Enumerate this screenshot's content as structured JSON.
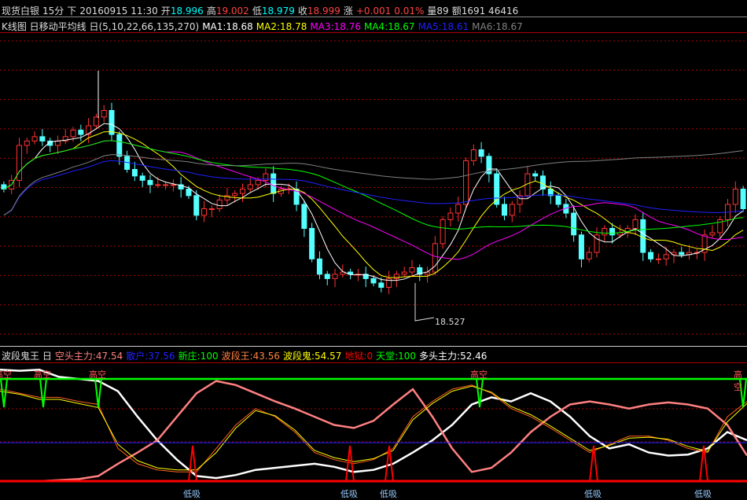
{
  "header": {
    "name": "现货白银",
    "period": "15分",
    "dir": "下",
    "datetime": "20160915 11:30",
    "open_label": "开",
    "open": "18.996",
    "high_label": "高",
    "high": "19.002",
    "low_label": "低",
    "low": "18.979",
    "close_label": "收",
    "close": "18.999",
    "chg_label": "涨",
    "chg": "+0.001",
    "pct": "0.01%",
    "vol": "量89",
    "amt": "额1691 46416"
  },
  "ma_line": {
    "title": "K线图 日移动平均线 日(5,10,22,66,135,270)",
    "ma": [
      {
        "t": "MA1:18.68",
        "c": "#ffffff"
      },
      {
        "t": "MA2:18.78",
        "c": "#ffff00"
      },
      {
        "t": "MA3:18.76",
        "c": "#ff00ff"
      },
      {
        "t": "MA4:18.67",
        "c": "#00ff00"
      },
      {
        "t": "MA5:18.61",
        "c": "#2020ff"
      },
      {
        "t": "MA6:18.67",
        "c": "#808080"
      }
    ]
  },
  "ind_line": {
    "title": "波段鬼王 日",
    "items": [
      {
        "t": "空头主力:47.54",
        "c": "#ff8080"
      },
      {
        "t": "散户:37.56",
        "c": "#2020ff"
      },
      {
        "t": "新庄:100",
        "c": "#00ff00"
      },
      {
        "t": "波段王:43.56",
        "c": "#ff8040"
      },
      {
        "t": "波段鬼:54.57",
        "c": "#ffff00"
      },
      {
        "t": "地狱:0",
        "c": "#ff0000"
      },
      {
        "t": "天堂:100",
        "c": "#00ff00"
      },
      {
        "t": "多头主力:52.46",
        "c": "#ffffff"
      }
    ]
  },
  "low_mark": "18.527",
  "signals": {
    "high_label": "高空",
    "low_label": "低吸"
  },
  "chart_data": [
    {
      "type": "candlestick",
      "title": "现货白银 15分",
      "ylim": [
        18.4,
        19.8
      ],
      "closes": [
        19.13,
        19.17,
        19.33,
        19.35,
        19.37,
        19.35,
        19.33,
        19.35,
        19.37,
        19.4,
        19.38,
        19.42,
        19.46,
        19.49,
        19.38,
        19.28,
        19.22,
        19.19,
        19.17,
        19.15,
        19.15,
        19.15,
        19.15,
        19.13,
        19.1,
        19.01,
        19.04,
        19.04,
        19.08,
        19.1,
        19.11,
        19.13,
        19.15,
        19.17,
        19.2,
        19.11,
        19.13,
        19.13,
        19.06,
        18.95,
        18.81,
        18.74,
        18.72,
        18.74,
        18.75,
        18.74,
        18.74,
        18.72,
        18.7,
        18.68,
        18.72,
        18.74,
        18.75,
        18.77,
        18.74,
        18.75,
        18.88,
        18.99,
        19.02,
        19.06,
        19.26,
        19.31,
        19.28,
        19.2,
        19.06,
        19.01,
        19.06,
        19.1,
        19.2,
        19.19,
        19.13,
        19.1,
        19.06,
        19.02,
        18.92,
        18.81,
        18.84,
        18.92,
        18.95,
        18.92,
        18.93,
        18.95,
        18.99,
        18.84,
        18.81,
        18.81,
        18.83,
        18.84,
        18.83,
        18.84,
        18.84,
        18.92,
        18.93,
        18.99,
        19.06,
        19.13,
        19.04
      ],
      "low_point": 18.527,
      "high_point": 19.67
    },
    {
      "type": "line",
      "title": "波段鬼王",
      "ylim": [
        0,
        100
      ],
      "series": [
        {
          "name": "多头主力",
          "color": "#ffffff",
          "values": [
            109,
            108,
            109,
            102,
            100,
            98,
            88,
            63,
            40,
            21,
            5,
            3,
            6,
            11,
            13,
            15,
            17,
            14,
            9,
            11,
            17,
            28,
            40,
            55,
            75,
            82,
            78,
            86,
            78,
            63,
            44,
            32,
            36,
            28,
            25,
            26,
            32,
            48,
            40
          ]
        },
        {
          "name": "空头主力",
          "color": "#ff8080",
          "values": [
            0,
            0,
            0,
            1,
            2,
            5,
            17,
            28,
            40,
            63,
            86,
            98,
            94,
            86,
            78,
            71,
            63,
            55,
            52,
            59,
            75,
            90,
            63,
            32,
            9,
            13,
            28,
            48,
            63,
            75,
            78,
            75,
            71,
            75,
            77,
            75,
            71,
            55,
            25
          ]
        },
        {
          "name": "波段王",
          "color": "#ff6020",
          "values": [
            90,
            86,
            82,
            82,
            78,
            75,
            32,
            17,
            11,
            9,
            9,
            32,
            55,
            71,
            63,
            48,
            28,
            21,
            17,
            21,
            32,
            63,
            78,
            90,
            94,
            86,
            71,
            63,
            52,
            40,
            28,
            36,
            44,
            44,
            40,
            32,
            28,
            63,
            78
          ]
        },
        {
          "name": "波段鬼",
          "color": "#ffff00",
          "values": [
            88,
            85,
            80,
            80,
            76,
            72,
            36,
            20,
            13,
            11,
            11,
            28,
            52,
            69,
            64,
            50,
            30,
            23,
            19,
            22,
            30,
            60,
            76,
            88,
            93,
            87,
            73,
            65,
            54,
            42,
            30,
            35,
            42,
            43,
            41,
            34,
            29,
            58,
            76
          ]
        },
        {
          "name": "散户",
          "color": "#2020ff",
          "values": [
            37.56,
            37.56
          ]
        },
        {
          "name": "天堂",
          "color": "#00ff00",
          "values": [
            100,
            100
          ]
        }
      ],
      "low_signals_x_index": [
        49,
        89,
        99,
        151,
        179
      ],
      "high_signals_x_index": [
        1,
        11,
        25,
        122,
        189
      ]
    }
  ]
}
